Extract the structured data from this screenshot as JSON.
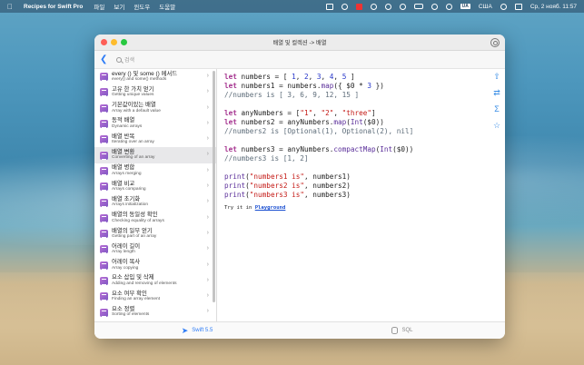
{
  "menubar": {
    "app_name": "Recipes for Swift Pro",
    "menus": [
      "파일",
      "보기",
      "윈도우",
      "도움말"
    ],
    "input_lang": "США",
    "clock": "Ср, 2 нояб.  11:57"
  },
  "window": {
    "title": "배열 및 컬렉션 -> 배열",
    "search_placeholder": "검색"
  },
  "sidebar": {
    "items": [
      {
        "title": "every () 및 some () 메서드",
        "subtitle": "every() and some() methods"
      },
      {
        "title": "고유 한 가치 얻기",
        "subtitle": "Getting unique values"
      },
      {
        "title": "기본값이있는 배열",
        "subtitle": "Array with a default value"
      },
      {
        "title": "동적 배열",
        "subtitle": "Dynamic arrays"
      },
      {
        "title": "배열 반복",
        "subtitle": "Iterating over an array"
      },
      {
        "title": "배열 변환",
        "subtitle": "Converting of an array"
      },
      {
        "title": "배열 병합",
        "subtitle": "Arrays merging"
      },
      {
        "title": "배열 비교",
        "subtitle": "Arrays comparing"
      },
      {
        "title": "배열 초기화",
        "subtitle": "Arrays initialization"
      },
      {
        "title": "배열의 동일성 확인",
        "subtitle": "Checking equality of arrays"
      },
      {
        "title": "배열의 일부 얻기",
        "subtitle": "Getting part of an array"
      },
      {
        "title": "어레이 길이",
        "subtitle": "Array length"
      },
      {
        "title": "어레이 복사",
        "subtitle": "Array copying"
      },
      {
        "title": "요소 삽입 및 삭제",
        "subtitle": "Adding and removing of elements"
      },
      {
        "title": "요소 여부 확인",
        "subtitle": "Finding an array element"
      },
      {
        "title": "요소 정렬",
        "subtitle": "Sorting of elements"
      }
    ],
    "selected_index": 5
  },
  "code": {
    "try_prefix": "Try it in",
    "try_link": "Playground"
  },
  "bottom_tabs": {
    "swift": "Swift 5.5",
    "sql": "SQL"
  }
}
